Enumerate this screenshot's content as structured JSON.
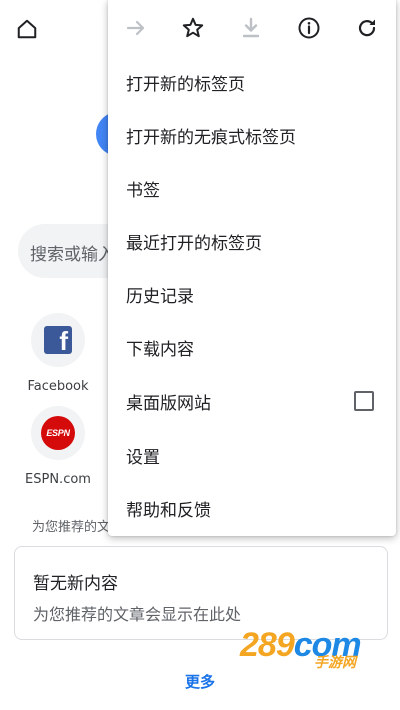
{
  "background": {
    "search_placeholder": "搜索或输入",
    "tiles": [
      {
        "label": "Facebook",
        "icon": "facebook-icon",
        "glyph": "f"
      },
      {
        "label": "ESPN.com",
        "icon": "espn-icon",
        "glyph": "ESPN"
      }
    ],
    "recommend_header": "为您推荐的文",
    "card": {
      "title": "暂无新内容",
      "subtitle": "为您推荐的文章会显示在此处"
    },
    "more_label": "更多",
    "watermark": {
      "number": "289",
      "suffix": "com",
      "sub": "手游网"
    }
  },
  "menu": {
    "toolbar": [
      "forward-icon",
      "star-icon",
      "download-icon",
      "info-icon",
      "refresh-icon"
    ],
    "items": [
      {
        "label": "打开新的标签页"
      },
      {
        "label": "打开新的无痕式标签页"
      },
      {
        "label": "书签"
      },
      {
        "label": "最近打开的标签页"
      },
      {
        "label": "历史记录"
      },
      {
        "label": "下载内容"
      },
      {
        "label": "桌面版网站",
        "checkbox": false
      },
      {
        "label": "设置"
      },
      {
        "label": "帮助和反馈"
      }
    ]
  },
  "colors": {
    "accent": "#1a73e8",
    "text": "#202124",
    "icon": "#202124",
    "disabled_icon": "#bdc1c6",
    "facebook": "#3b5998",
    "espn": "#d50a0a"
  }
}
